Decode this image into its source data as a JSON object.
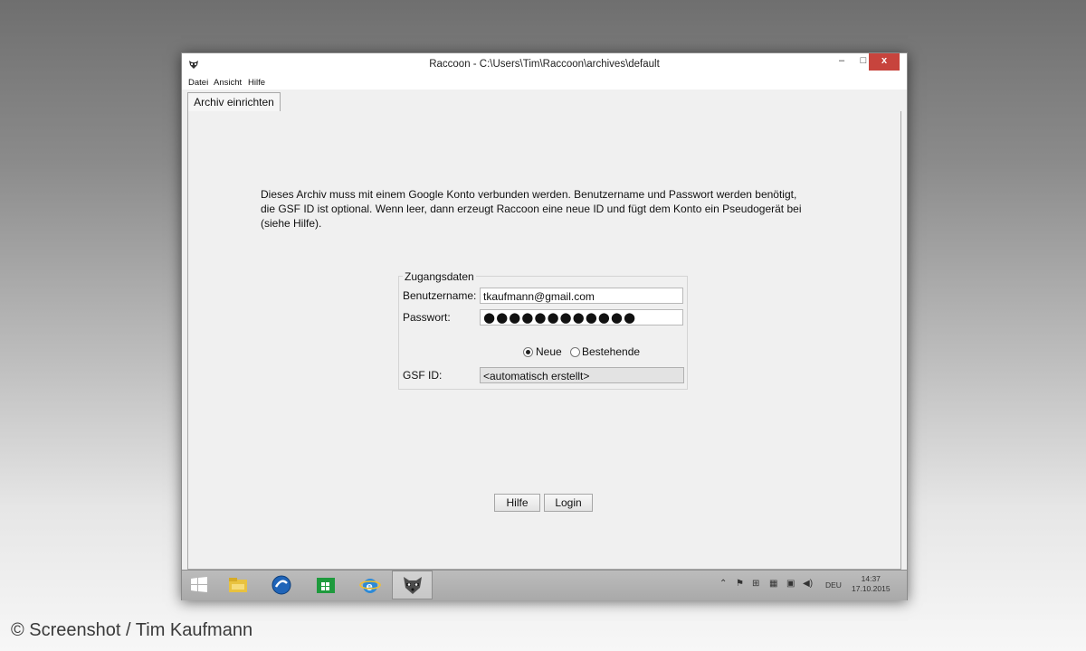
{
  "window": {
    "title": "Raccoon - C:\\Users\\Tim\\Raccoon\\archives\\default",
    "minimize": "–",
    "maximize": "□",
    "close": "x"
  },
  "menu": [
    "Datei",
    "Ansicht",
    "Hilfe"
  ],
  "tab": {
    "label": "Archiv einrichten"
  },
  "info_lines": [
    "Dieses Archiv muss mit einem Google Konto verbunden werden. Benutzername und Passwort werden benötigt,",
    "die GSF ID ist optional. Wenn leer, dann erzeugt Raccoon eine neue ID und fügt dem Konto ein Pseudogerät bei",
    "(siehe Hilfe)."
  ],
  "credentials": {
    "legend": "Zugangsdaten",
    "username_label": "Benutzername:",
    "username_value": "tkaufmann@gmail.com",
    "password_label": "Passwort:",
    "password_value": "●●●●●●●●●●●●",
    "radio_new": "Neue",
    "radio_existing": "Bestehende",
    "gsf_label": "GSF ID:",
    "gsf_value": "<automatisch erstellt>"
  },
  "buttons": {
    "help": "Hilfe",
    "login": "Login"
  },
  "taskbar": {
    "icons": [
      "windows-start-icon",
      "file-explorer-icon",
      "browser-icon",
      "store-icon",
      "internet-explorer-icon",
      "raccoon-app-icon"
    ],
    "language": "DEU",
    "time": "14:37",
    "date": "17.10.2015"
  },
  "watermark": "© Screenshot / Tim Kaufmann"
}
